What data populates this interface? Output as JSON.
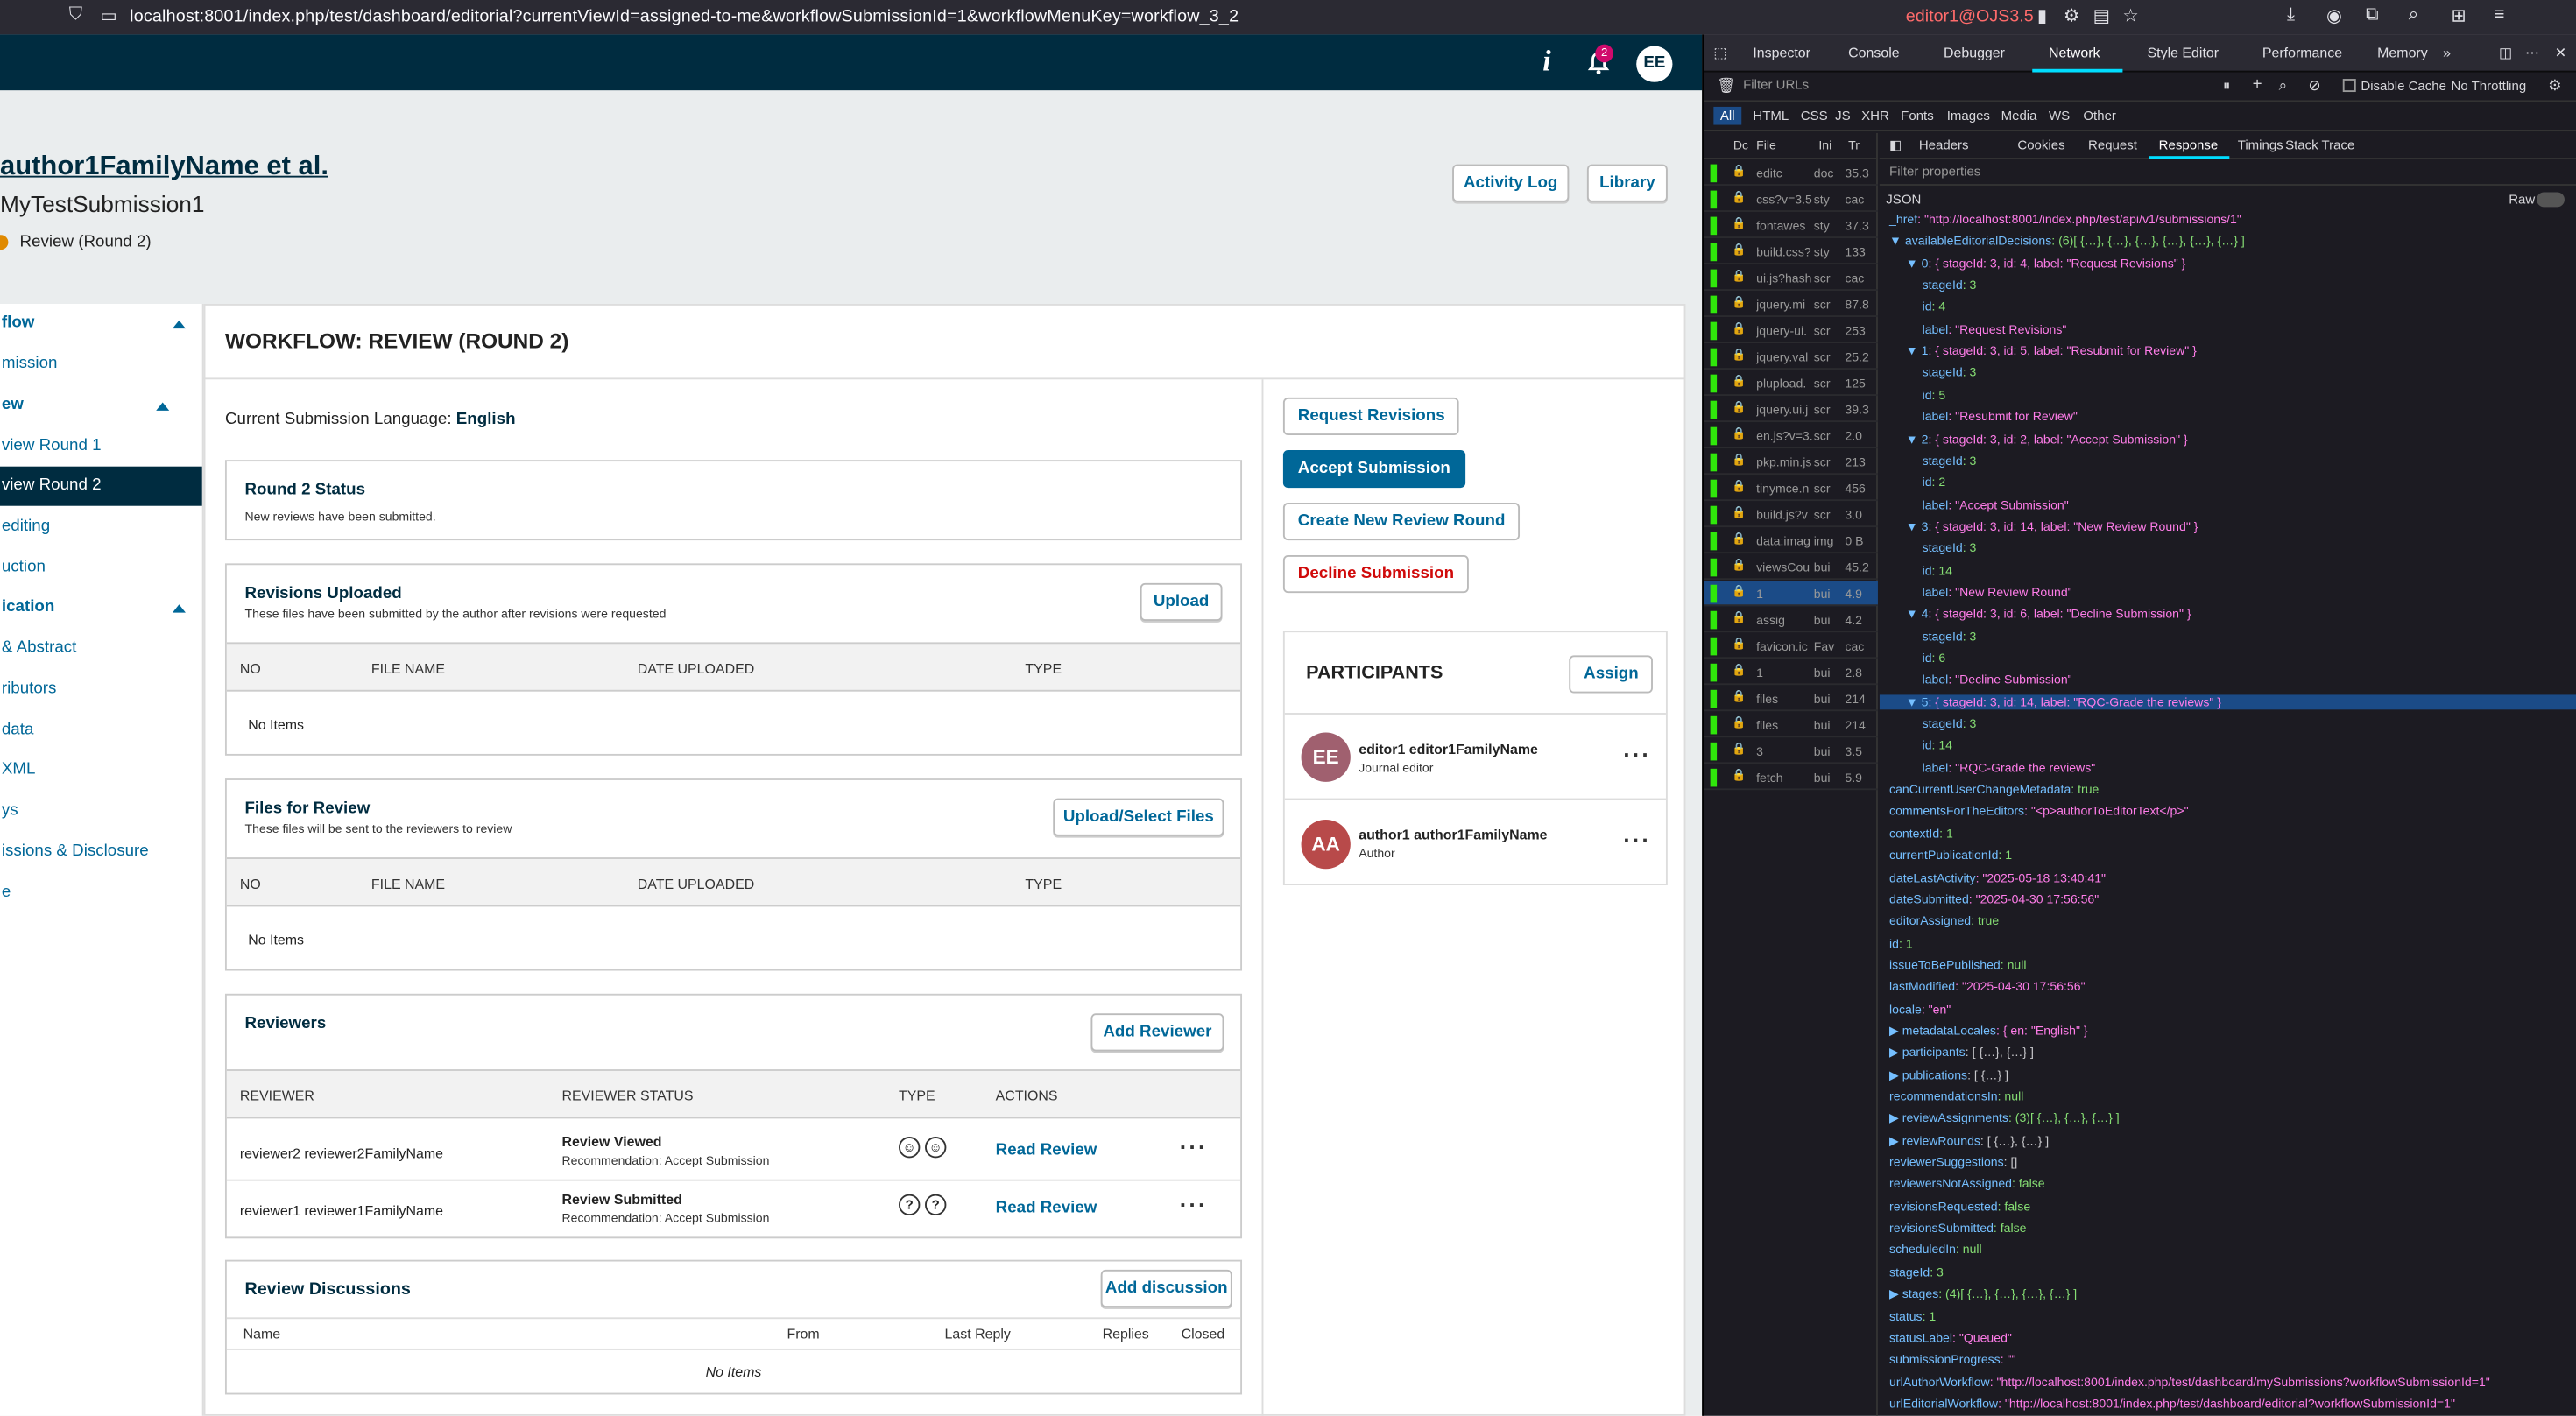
{
  "browser": {
    "url": "localhost:8001/index.php/test/dashboard/editorial?currentViewId=assigned-to-me&workflowSubmissionId=1&workflowMenuKey=workflow_3_2",
    "user": "editor1@OJS3.5"
  },
  "header": {
    "notification_count": "2",
    "user_initials": "EE"
  },
  "submission": {
    "authors": "author1FamilyName et al.",
    "title": "MyTestSubmission1",
    "stage": "Review (Round 2)",
    "activity_log": "Activity Log",
    "library": "Library"
  },
  "nav": {
    "items": [
      {
        "label": "flow"
      },
      {
        "label": "mission"
      },
      {
        "label": "ew"
      },
      {
        "label": "view Round 1"
      },
      {
        "label": "view Round 2"
      },
      {
        "label": "editing"
      },
      {
        "label": "uction"
      },
      {
        "label": "ication"
      },
      {
        "label": "& Abstract"
      },
      {
        "label": "ributors"
      },
      {
        "label": "data"
      },
      {
        "label": "XML"
      },
      {
        "label": "ys"
      },
      {
        "label": "issions & Disclosure"
      },
      {
        "label": "e"
      }
    ]
  },
  "workflow": {
    "title": "WORKFLOW: REVIEW (ROUND 2)",
    "language_label": "Current Submission Language:",
    "language_value": "English",
    "status": {
      "title": "Round 2 Status",
      "text": "New reviews have been submitted."
    },
    "revisions": {
      "title": "Revisions Uploaded",
      "desc": "These files have been submitted by the author after revisions were requested",
      "upload": "Upload",
      "cols": [
        "NO",
        "FILE NAME",
        "DATE UPLOADED",
        "TYPE"
      ],
      "empty": "No Items"
    },
    "files": {
      "title": "Files for Review",
      "desc": "These files will be sent to the reviewers to review",
      "upload": "Upload/Select Files",
      "cols": [
        "NO",
        "FILE NAME",
        "DATE UPLOADED",
        "TYPE"
      ],
      "empty": "No Items"
    },
    "reviewers": {
      "title": "Reviewers",
      "add": "Add Reviewer",
      "cols": [
        "REVIEWER",
        "REVIEWER STATUS",
        "TYPE",
        "ACTIONS"
      ],
      "rows": [
        {
          "name": "reviewer2 reviewer2FamilyName",
          "status": "Review Viewed",
          "rec": "Recommendation: Accept Submission",
          "action": "Read Review"
        },
        {
          "name": "reviewer1 reviewer1FamilyName",
          "status": "Review Submitted",
          "rec": "Recommendation: Accept Submission",
          "action": "Read Review"
        }
      ]
    },
    "discussions": {
      "title": "Review Discussions",
      "add": "Add discussion",
      "cols": [
        "Name",
        "From",
        "Last Reply",
        "Replies",
        "Closed"
      ],
      "empty": "No Items"
    }
  },
  "decisions": {
    "request": "Request Revisions",
    "accept": "Accept Submission",
    "new_round": "Create New Review Round",
    "decline": "Decline Submission"
  },
  "participants": {
    "title": "PARTICIPANTS",
    "assign": "Assign",
    "people": [
      {
        "initials": "EE",
        "name": "editor1 editor1FamilyName",
        "role": "Journal editor",
        "color": "#a0606f"
      },
      {
        "initials": "AA",
        "name": "author1 author1FamilyName",
        "role": "Author",
        "color": "#b84a4a"
      }
    ]
  },
  "devtools": {
    "tabs": [
      "Inspector",
      "Console",
      "Debugger",
      "Network",
      "Style Editor",
      "Performance",
      "Memory"
    ],
    "filter_urls": "Filter URLs",
    "disable_cache": "Disable Cache",
    "throttling": "No Throttling",
    "types": [
      "All",
      "HTML",
      "CSS",
      "JS",
      "XHR",
      "Fonts",
      "Images",
      "Media",
      "WS",
      "Other"
    ],
    "detail_tabs": [
      "Headers",
      "Cookies",
      "Request",
      "Response",
      "Timings",
      "Stack Trace"
    ],
    "filter_props": "Filter properties",
    "json_label": "JSON",
    "raw_label": "Raw",
    "requests": [
      {
        "file": "editc",
        "type": "doc",
        "size": "35.3"
      },
      {
        "file": "css?v=3.5",
        "type": "sty",
        "size": "cac"
      },
      {
        "file": "fontawes",
        "type": "sty",
        "size": "37.3"
      },
      {
        "file": "build.css?",
        "type": "sty",
        "size": "133"
      },
      {
        "file": "ui.js?hash",
        "type": "scr",
        "size": "cac"
      },
      {
        "file": "jquery.mi",
        "type": "scr",
        "size": "87.8"
      },
      {
        "file": "jquery-ui.",
        "type": "scr",
        "size": "253"
      },
      {
        "file": "jquery.val",
        "type": "scr",
        "size": "25.2"
      },
      {
        "file": "plupload.",
        "type": "scr",
        "size": "125"
      },
      {
        "file": "jquery.ui.j",
        "type": "scr",
        "size": "39.3"
      },
      {
        "file": "en.js?v=3.",
        "type": "scr",
        "size": "2.0"
      },
      {
        "file": "pkp.min.js",
        "type": "scr",
        "size": "213"
      },
      {
        "file": "tinymce.n",
        "type": "scr",
        "size": "456"
      },
      {
        "file": "build.js?v",
        "type": "scr",
        "size": "3.0"
      },
      {
        "file": "data:imag",
        "type": "img",
        "size": "0 B"
      },
      {
        "file": "viewsCou",
        "type": "bui",
        "size": "45.2"
      },
      {
        "file": "1",
        "type": "bui",
        "size": "4.9"
      },
      {
        "file": "assig",
        "type": "bui",
        "size": "4.2"
      },
      {
        "file": "favicon.ic",
        "type": "Fav",
        "size": "cac"
      },
      {
        "file": "1",
        "type": "bui",
        "size": "2.8"
      },
      {
        "file": "files",
        "type": "bui",
        "size": "214"
      },
      {
        "file": "files",
        "type": "bui",
        "size": "214"
      },
      {
        "file": "3",
        "type": "bui",
        "size": "3.5"
      },
      {
        "file": "fetch",
        "type": "bui",
        "size": "5.9"
      }
    ],
    "json_lines": [
      {
        "indent": 0,
        "text": "_href: \"http://localhost:8001/index.php/test/api/v1/submissions/1\""
      },
      {
        "indent": 0,
        "text": "▼ availableEditorialDecisions: (6)[ {…}, {…}, {…}, {…}, {…}, {…} ]"
      },
      {
        "indent": 1,
        "text": "▼ 0: { stageId: 3, id: 4, label: \"Request Revisions\" }"
      },
      {
        "indent": 2,
        "text": "stageId: 3"
      },
      {
        "indent": 2,
        "text": "id: 4"
      },
      {
        "indent": 2,
        "text": "label: \"Request Revisions\""
      },
      {
        "indent": 1,
        "text": "▼ 1: { stageId: 3, id: 5, label: \"Resubmit for Review\" }"
      },
      {
        "indent": 2,
        "text": "stageId: 3"
      },
      {
        "indent": 2,
        "text": "id: 5"
      },
      {
        "indent": 2,
        "text": "label: \"Resubmit for Review\""
      },
      {
        "indent": 1,
        "text": "▼ 2: { stageId: 3, id: 2, label: \"Accept Submission\" }"
      },
      {
        "indent": 2,
        "text": "stageId: 3"
      },
      {
        "indent": 2,
        "text": "id: 2"
      },
      {
        "indent": 2,
        "text": "label: \"Accept Submission\""
      },
      {
        "indent": 1,
        "text": "▼ 3: { stageId: 3, id: 14, label: \"New Review Round\" }"
      },
      {
        "indent": 2,
        "text": "stageId: 3"
      },
      {
        "indent": 2,
        "text": "id: 14"
      },
      {
        "indent": 2,
        "text": "label: \"New Review Round\""
      },
      {
        "indent": 1,
        "text": "▼ 4: { stageId: 3, id: 6, label: \"Decline Submission\" }"
      },
      {
        "indent": 2,
        "text": "stageId: 3"
      },
      {
        "indent": 2,
        "text": "id: 6"
      },
      {
        "indent": 2,
        "text": "label: \"Decline Submission\""
      },
      {
        "indent": 1,
        "text": "▼ 5: { stageId: 3, id: 14, label: \"RQC-Grade the reviews\" }",
        "hl": true
      },
      {
        "indent": 2,
        "text": "stageId: 3"
      },
      {
        "indent": 2,
        "text": "id: 14"
      },
      {
        "indent": 2,
        "text": "label: \"RQC-Grade the reviews\""
      },
      {
        "indent": 0,
        "text": "canCurrentUserChangeMetadata: true"
      },
      {
        "indent": 0,
        "text": "commentsForTheEditors: \"<p>authorToEditorText</p>\""
      },
      {
        "indent": 0,
        "text": "contextId: 1"
      },
      {
        "indent": 0,
        "text": "currentPublicationId: 1"
      },
      {
        "indent": 0,
        "text": "dateLastActivity: \"2025-05-18 13:40:41\""
      },
      {
        "indent": 0,
        "text": "dateSubmitted: \"2025-04-30 17:56:56\""
      },
      {
        "indent": 0,
        "text": "editorAssigned: true"
      },
      {
        "indent": 0,
        "text": "id: 1"
      },
      {
        "indent": 0,
        "text": "issueToBePublished: null"
      },
      {
        "indent": 0,
        "text": "lastModified: \"2025-04-30 17:56:56\""
      },
      {
        "indent": 0,
        "text": "locale: \"en\""
      },
      {
        "indent": 0,
        "text": "▶ metadataLocales: { en: \"English\" }"
      },
      {
        "indent": 0,
        "text": "▶ participants: [ {…}, {…} ]"
      },
      {
        "indent": 0,
        "text": "▶ publications: [ {…} ]"
      },
      {
        "indent": 0,
        "text": "recommendationsIn: null"
      },
      {
        "indent": 0,
        "text": "▶ reviewAssignments: (3)[ {…}, {…}, {…} ]"
      },
      {
        "indent": 0,
        "text": "▶ reviewRounds: [ {…}, {…} ]"
      },
      {
        "indent": 0,
        "text": "reviewerSuggestions: []"
      },
      {
        "indent": 0,
        "text": "reviewersNotAssigned: false"
      },
      {
        "indent": 0,
        "text": "revisionsRequested: false"
      },
      {
        "indent": 0,
        "text": "revisionsSubmitted: false"
      },
      {
        "indent": 0,
        "text": "scheduledIn: null"
      },
      {
        "indent": 0,
        "text": "stageId: 3"
      },
      {
        "indent": 0,
        "text": "▶ stages: (4)[ {…}, {…}, {…}, {…} ]"
      },
      {
        "indent": 0,
        "text": "status: 1"
      },
      {
        "indent": 0,
        "text": "statusLabel: \"Queued\""
      },
      {
        "indent": 0,
        "text": "submissionProgress: \"\""
      },
      {
        "indent": 0,
        "text": "urlAuthorWorkflow: \"http://localhost:8001/index.php/test/dashboard/mySubmissions?workflowSubmissionId=1\""
      },
      {
        "indent": 0,
        "text": "urlEditorialWorkflow: \"http://localhost:8001/index.php/test/dashboard/editorial?workflowSubmissionId=1\""
      }
    ]
  }
}
